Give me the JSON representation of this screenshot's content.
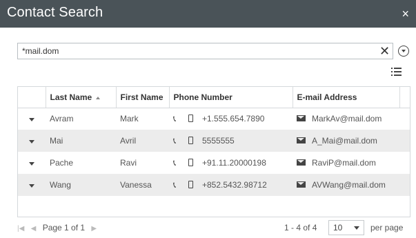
{
  "window": {
    "title": "Contact Search",
    "close_glyph": "×"
  },
  "search": {
    "value": "*mail.dom",
    "clear_glyph": "✕"
  },
  "table": {
    "headers": [
      "Last Name",
      "First Name",
      "Phone Number",
      "E-mail Address"
    ],
    "rows": [
      {
        "last": "Avram",
        "first": "Mark",
        "phone": "+1.555.654.7890",
        "email": "MarkAv@mail.dom"
      },
      {
        "last": "Mai",
        "first": "Avril",
        "phone": "5555555",
        "email": "A_Mai@mail.dom"
      },
      {
        "last": "Pache",
        "first": "Ravi",
        "phone": "+91.11.20000198",
        "email": "RaviP@mail.dom"
      },
      {
        "last": "Wang",
        "first": "Vanessa",
        "phone": "+852.5432.98712",
        "email": "AVWang@mail.dom"
      }
    ]
  },
  "pager": {
    "first_glyph": "|◀",
    "prev_glyph": "◀",
    "next_glyph": "▶",
    "page_text": "Page 1 of 1",
    "range_text": "1 - 4 of 4",
    "per_page_value": "10",
    "per_page_label": "per page"
  },
  "icons": {
    "phone": "phone-icon",
    "mobile": "mobile-icon",
    "mail": "mail-icon"
  },
  "colors": {
    "title_bar": "#4a5358",
    "row_alt": "#ececec"
  }
}
